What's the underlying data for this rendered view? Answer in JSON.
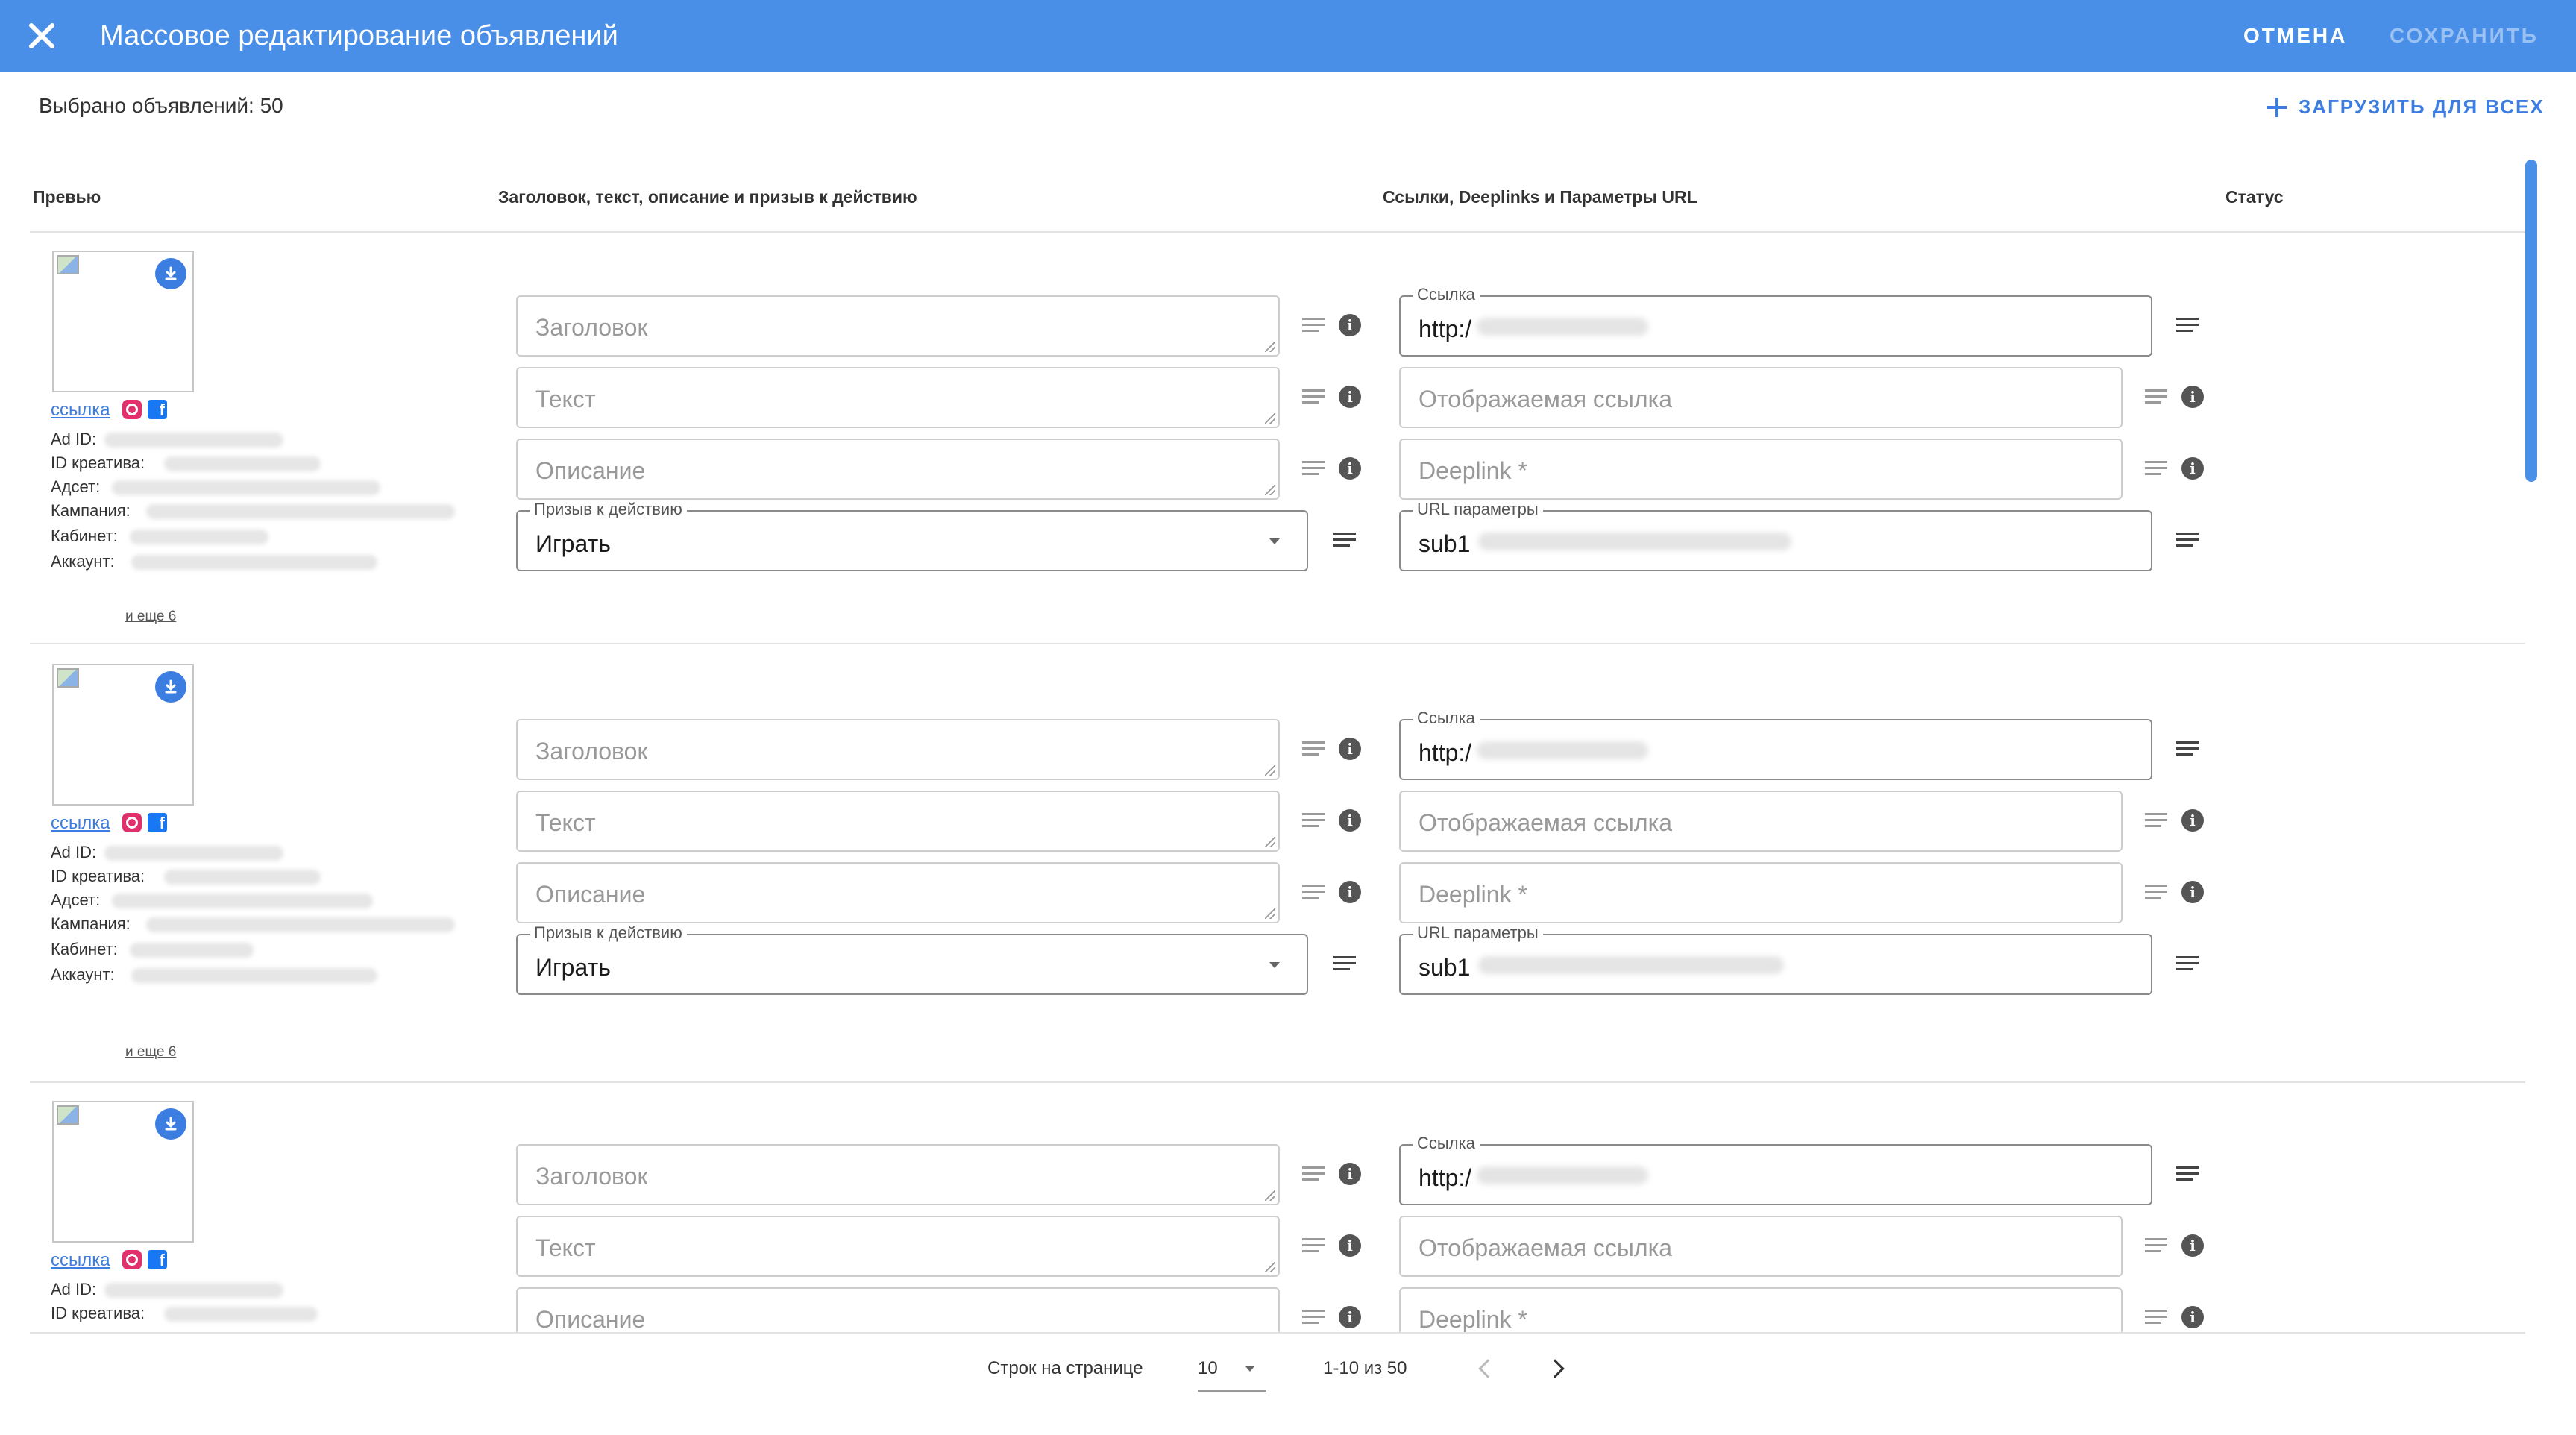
{
  "appbar": {
    "title": "Массовое редактирование объявлений",
    "cancel_label": "ОТМЕНА",
    "save_label": "СОХРАНИТЬ"
  },
  "toolbar": {
    "selected_label": "Выбрано объявлений: 50",
    "upload_all_label": "ЗАГРУЗИТЬ ДЛЯ ВСЕХ"
  },
  "columns": {
    "preview": "Превью",
    "texts": "Заголовок, текст, описание и призыв к действию",
    "links": "Ссылки, Deeplinks и Параметры URL",
    "status": "Статус"
  },
  "meta_labels": {
    "ad_id": "Ad ID:",
    "creative_id": "ID креатива:",
    "adset": "Адсет:",
    "campaign": "Кампания:",
    "cabinet": "Кабинет:",
    "account": "Аккаунт:"
  },
  "rows": [
    {
      "link_label": "ссылка",
      "more_label": "и еще 6",
      "headline_placeholder": "Заголовок",
      "text_placeholder": "Текст",
      "description_placeholder": "Описание",
      "cta_label": "Призыв к действию",
      "cta_value": "Играть",
      "url_label": "Ссылка",
      "url_value": "http:/",
      "display_link_placeholder": "Отображаемая ссылка",
      "deeplink_placeholder": "Deeplink *",
      "url_params_label": "URL параметры",
      "url_params_value": "sub1"
    },
    {
      "link_label": "ссылка",
      "more_label": "и еще 6",
      "headline_placeholder": "Заголовок",
      "text_placeholder": "Текст",
      "description_placeholder": "Описание",
      "cta_label": "Призыв к действию",
      "cta_value": "Играть",
      "url_label": "Ссылка",
      "url_value": "http:/",
      "display_link_placeholder": "Отображаемая ссылка",
      "deeplink_placeholder": "Deeplink *",
      "url_params_label": "URL параметры",
      "url_params_value": "sub1"
    },
    {
      "link_label": "ссылка",
      "headline_placeholder": "Заголовок",
      "text_placeholder": "Текст",
      "description_placeholder": "Описание",
      "url_label": "Ссылка",
      "url_value": "http:/",
      "display_link_placeholder": "Отображаемая ссылка",
      "deeplink_placeholder": "Deeplink *"
    }
  ],
  "pagination": {
    "rows_per_page_label": "Строк на странице",
    "rows_per_page_value": "10",
    "range_label": "1-10 из 50"
  },
  "colors": {
    "primary": "#4a8fe7",
    "link": "#3b7de0",
    "instagram": "#e1306c",
    "facebook": "#1877f2"
  },
  "icons": {
    "close": "close-icon",
    "download": "download-icon",
    "info": "info-icon",
    "lines": "lines-icon",
    "plus": "plus-icon"
  }
}
